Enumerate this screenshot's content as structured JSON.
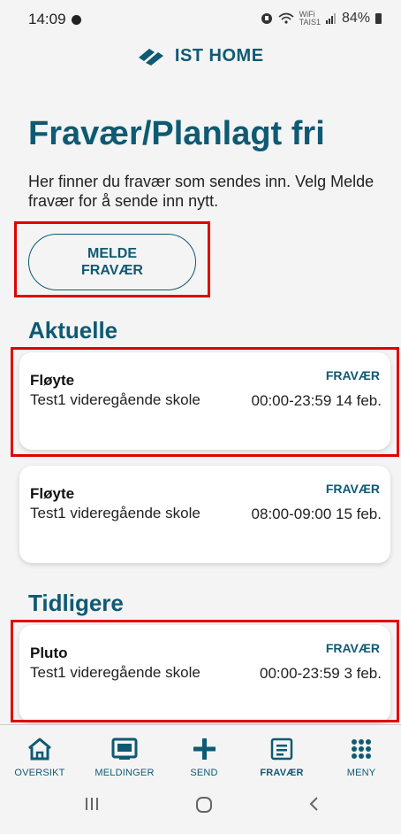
{
  "status": {
    "time": "14:09",
    "battery": "84%",
    "wifi_small": "WiFi",
    "wifi_sub": "TAIS1"
  },
  "logo": {
    "text": "IST HOME"
  },
  "page": {
    "title": "Fravær/Planlagt fri",
    "intro": "Her finner du fravær som sendes inn. Velg Melde fravær for å sende inn nytt.",
    "button_line1": "MELDE",
    "button_line2": "FRAVÆR"
  },
  "sections": {
    "current": "Aktuelle",
    "previous": "Tidligere"
  },
  "cards": [
    {
      "name": "Fløyte",
      "type": "FRAVÆR",
      "school": "Test1 videregående skole",
      "time": "00:00-23:59 14 feb."
    },
    {
      "name": "Fløyte",
      "type": "FRAVÆR",
      "school": "Test1 videregående skole",
      "time": "08:00-09:00 15 feb."
    },
    {
      "name": "Pluto",
      "type": "FRAVÆR",
      "school": "Test1 videregående skole",
      "time": "00:00-23:59 3 feb."
    }
  ],
  "nav": [
    {
      "label": "OVERSIKT",
      "icon": "home-icon"
    },
    {
      "label": "MELDINGER",
      "icon": "messages-icon"
    },
    {
      "label": "SEND",
      "icon": "plus-icon"
    },
    {
      "label": "FRAVÆR",
      "icon": "absence-icon",
      "active": true
    },
    {
      "label": "MENY",
      "icon": "grid-menu-icon"
    }
  ],
  "colors": {
    "primary": "#0e5a73",
    "highlight": "#e00000"
  }
}
